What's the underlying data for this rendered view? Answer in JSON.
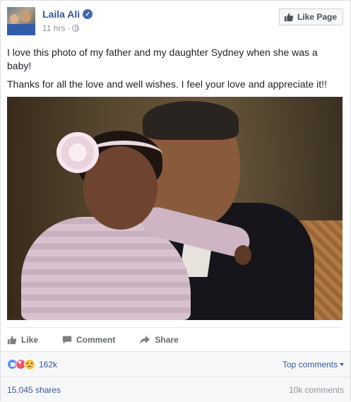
{
  "post": {
    "page_name": "Laila Ali",
    "verified_mark": "✓",
    "time": "11 hrs",
    "separator": "·",
    "like_page_label": "Like Page",
    "paragraphs": [
      "I love this photo of my father and my daughter Sydney when she was a baby!",
      "Thanks for all the love and well wishes. I feel your love and appreciate it!!"
    ]
  },
  "actions": {
    "like_label": "Like",
    "comment_label": "Comment",
    "share_label": "Share"
  },
  "reactions": {
    "count": "162k",
    "icons": [
      "like-reaction-icon",
      "love-reaction-icon",
      "sad-reaction-icon"
    ],
    "top_comments_label": "Top comments"
  },
  "footer": {
    "shares": "15,045 shares",
    "comments": "10k comments"
  },
  "colors": {
    "link_blue": "#365899",
    "meta_gray": "#90949c",
    "like_blue": "#5890ff",
    "love_red": "#f25268",
    "sad_yellow": "#f7c342"
  }
}
